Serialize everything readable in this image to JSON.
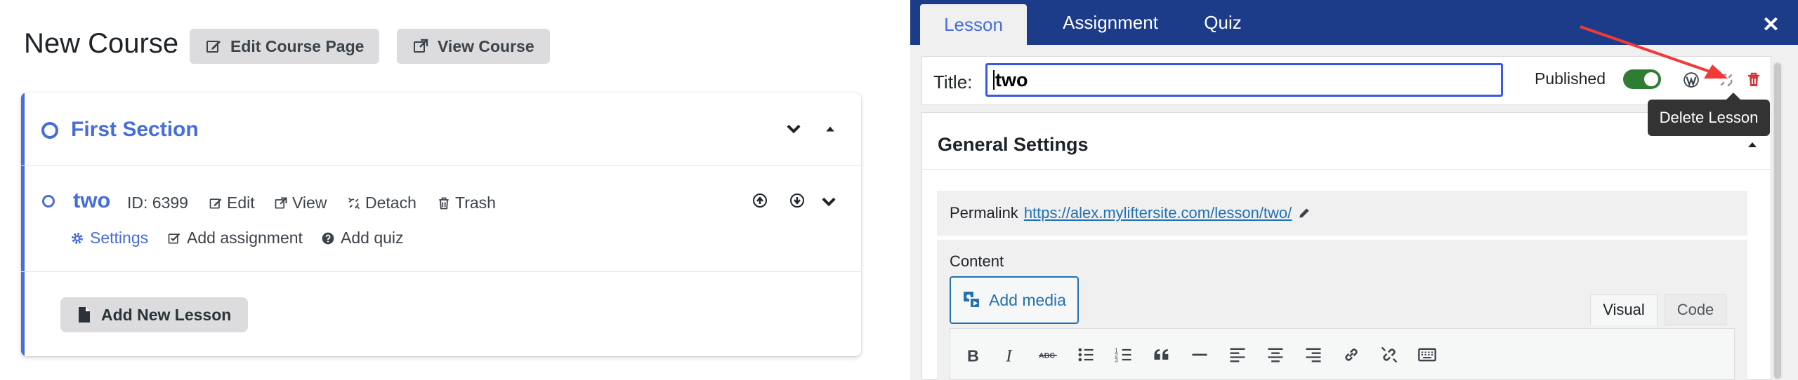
{
  "builder": {
    "page_title": "New Course",
    "edit_course_page_label": "Edit Course Page",
    "view_course_label": "View Course",
    "section": {
      "title": "First Section"
    },
    "lesson": {
      "name": "two",
      "id_text": "ID: 6399",
      "edit_label": "Edit",
      "view_label": "View",
      "detach_label": "Detach",
      "trash_label": "Trash",
      "settings_label": "Settings",
      "add_assignment_label": "Add assignment",
      "add_quiz_label": "Add quiz"
    },
    "add_new_lesson_label": "Add New Lesson"
  },
  "editor": {
    "tabs": [
      {
        "label": "Lesson",
        "active": true
      },
      {
        "label": "Assignment",
        "active": false
      },
      {
        "label": "Quiz",
        "active": false
      }
    ],
    "close_icon": "close-icon",
    "title_label": "Title:",
    "title_value": "two",
    "published_label": "Published",
    "published": true,
    "tooltip": "Delete Lesson",
    "general_settings_title": "General Settings",
    "permalink_label": "Permalink",
    "permalink_url": "https://alex.myliftersite.com/lesson/two/",
    "content_label": "Content",
    "add_media_label": "Add media",
    "visual_tab": "Visual",
    "code_tab": "Code",
    "toolbar_icons": [
      "bold-icon",
      "italic-icon",
      "strikethrough-icon",
      "bullet-list-icon",
      "numbered-list-icon",
      "blockquote-icon",
      "horizontal-rule-icon",
      "align-left-icon",
      "align-center-icon",
      "align-right-icon",
      "link-icon",
      "unlink-icon",
      "keyboard-icon"
    ]
  },
  "colors": {
    "accent": "#466dd8",
    "tabbar": "#1c3c8a",
    "toggle_on": "#2e7d32",
    "delete": "#d63638",
    "annotation_arrow": "#f03a3a"
  }
}
